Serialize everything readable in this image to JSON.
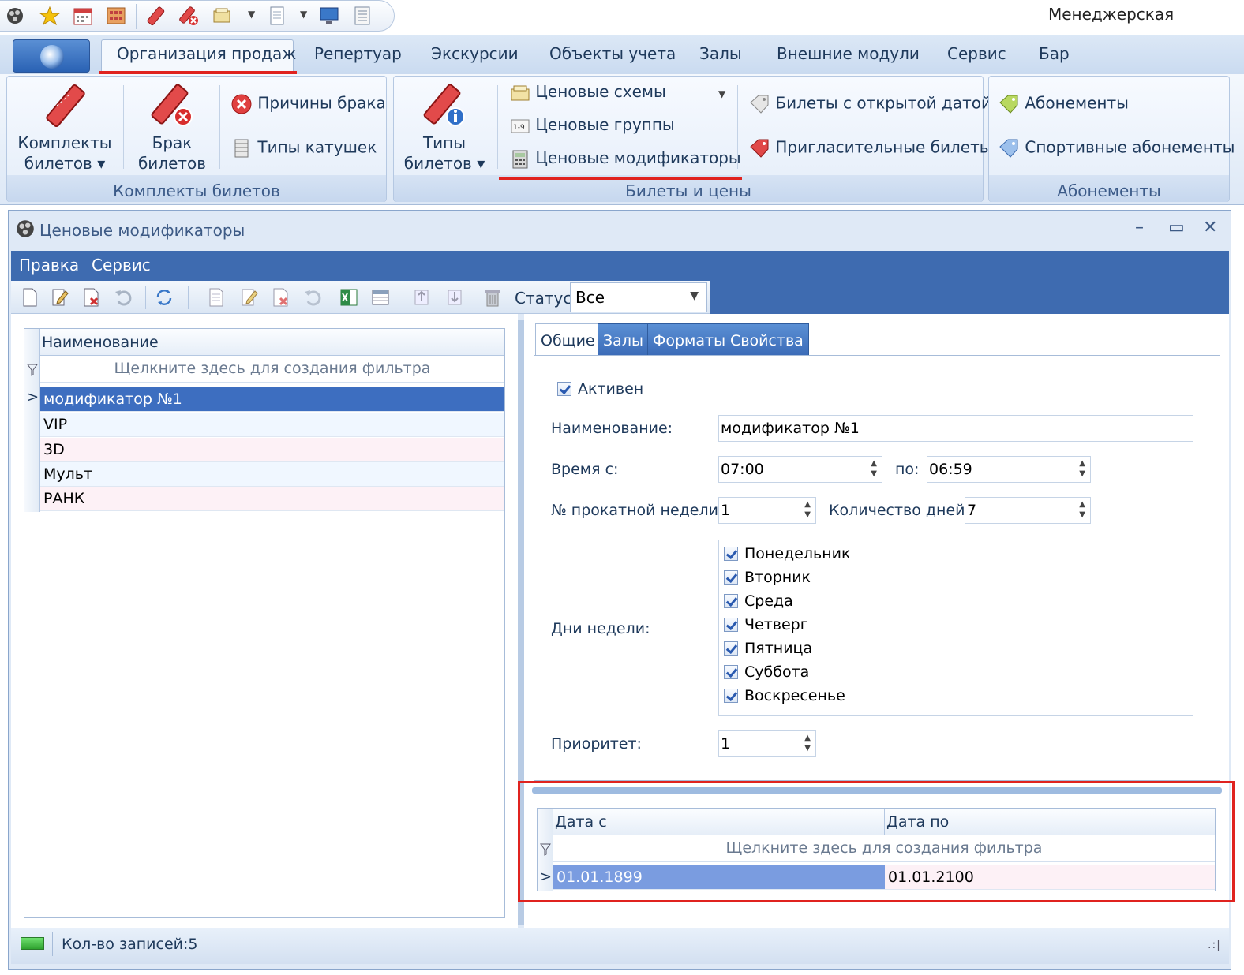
{
  "app": {
    "title": "Менеджерская"
  },
  "ribbon": {
    "tabs": [
      "Организация продаж",
      "Репертуар",
      "Экскурсии",
      "Объекты учета",
      "Залы",
      "Внешние модули",
      "Сервис",
      "Бар"
    ],
    "active_tab": "Организация продаж",
    "groups": {
      "kits": {
        "label": "Комплекты билетов",
        "kits_btn": [
          "Комплекты",
          "билетов ▾"
        ],
        "defect_btn": [
          "Брак",
          "билетов"
        ],
        "defect_reasons": "Причины брака",
        "reel_types": "Типы катушек"
      },
      "prices": {
        "label": "Билеты и цены",
        "ticket_types_btn": [
          "Типы",
          "билетов ▾"
        ],
        "price_schemes": "Ценовые схемы",
        "price_groups": "Ценовые группы",
        "price_modifiers": "Ценовые модификаторы",
        "open_date_tickets": "Билеты с открытой датой",
        "invitation_tickets": "Пригласительные билеты"
      },
      "subs": {
        "label": "Абонементы",
        "subscriptions": "Абонементы",
        "sport_subscriptions": "Спортивные абонементы"
      }
    }
  },
  "window": {
    "title": "Ценовые модификаторы",
    "menu": [
      "Правка",
      "Сервис"
    ],
    "status_label": "Статус",
    "status_value": "Все"
  },
  "left_grid": {
    "column": "Наименование",
    "filter_hint": "Щелкните здесь для создания фильтра",
    "rows": [
      "модификатор №1",
      "VIP",
      "3D",
      "Мульт",
      "РАНК"
    ]
  },
  "tabs": [
    "Общие",
    "Залы",
    "Форматы",
    "Свойства"
  ],
  "form": {
    "active_label": "Активен",
    "name_label": "Наименование:",
    "name_value": "модификатор №1",
    "time_from_label": "Время с:",
    "time_from": "07:00",
    "time_to_label": "по:",
    "time_to": "06:59",
    "week_label": "№ прокатной недели:",
    "week_value": "1",
    "days_count_label": "Количество дней:",
    "days_count": "7",
    "weekdays_label": "Дни недели:",
    "weekdays": [
      "Понедельник",
      "Вторник",
      "Среда",
      "Четверг",
      "Пятница",
      "Суббота",
      "Воскресенье"
    ],
    "priority_label": "Приоритет:",
    "priority": "1"
  },
  "dates_grid": {
    "col_from": "Дата с",
    "col_to": "Дата по",
    "filter_hint": "Щелкните здесь для создания фильтра",
    "row": {
      "from": "01.01.1899",
      "to": "01.01.2100"
    }
  },
  "statusbar": {
    "records": "Кол-во записей:5"
  },
  "colors": {
    "accent": "#3e6bb0",
    "highlight": "#e0231f",
    "selection": "#3d6ec0"
  }
}
